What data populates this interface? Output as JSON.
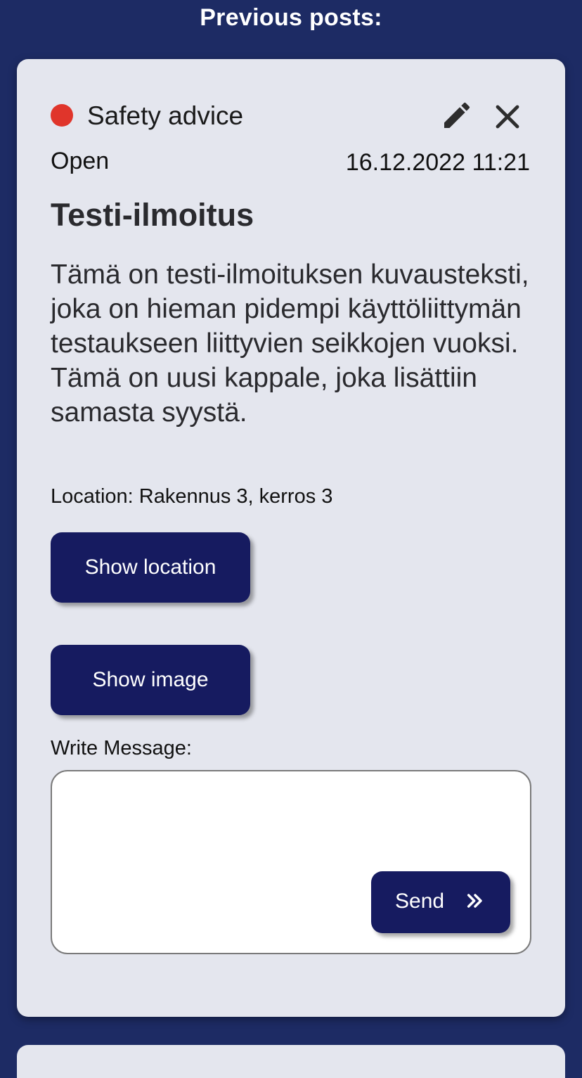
{
  "section": {
    "title": "Previous posts:"
  },
  "post": {
    "status_color": "#e0352b",
    "category": "Safety advice",
    "state": "Open",
    "timestamp": "16.12.2022 11:21",
    "title": "Testi-ilmoitus",
    "body": "Tämä on testi-ilmoituksen kuvausteksti, joka on hieman pidempi käyttöliittymän testaukseen liittyvien seikkojen vuoksi. Tämä on uusi kappale, joka lisättiin samasta syystä.",
    "location": "Location: Rakennus 3, kerros 3",
    "actions": {
      "show_location": "Show location",
      "show_image": "Show image",
      "edit_icon": "pencil-icon",
      "close_icon": "close-icon"
    },
    "message": {
      "label": "Write Message:",
      "value": "",
      "send_label": "Send",
      "send_icon": "double-chevron-right-icon"
    }
  },
  "colors": {
    "page_background": "#1d2b64",
    "card_background": "#e4e6ee",
    "button_background": "#161b60"
  }
}
